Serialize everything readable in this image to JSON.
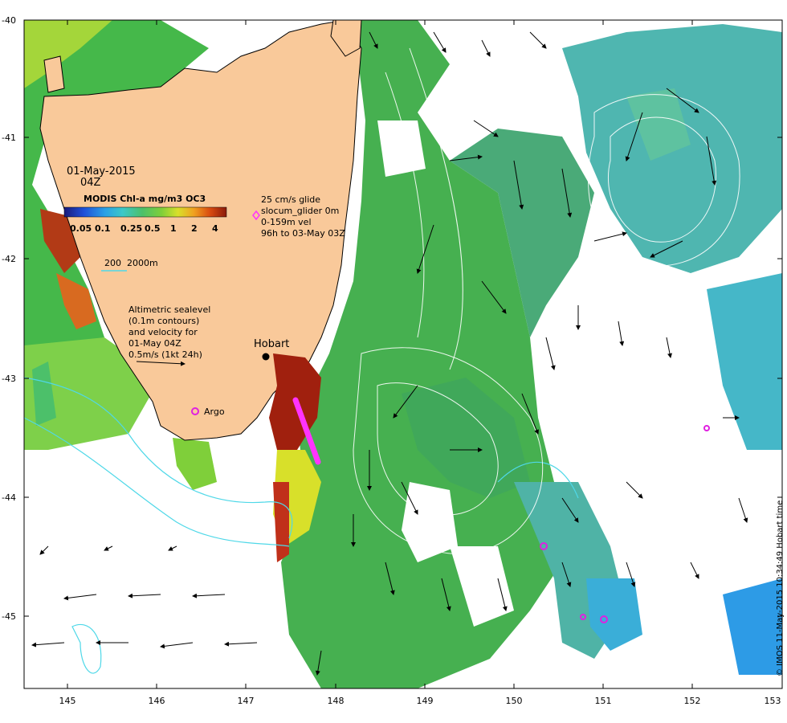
{
  "map": {
    "date": "01-May-2015",
    "time": "04Z",
    "colorbar": {
      "title": "MODIS Chl-a mg/m3 OC3",
      "tick_labels": [
        "0.05",
        "0.1",
        "0.25",
        "0.5",
        "1",
        "2",
        "4"
      ],
      "colors": [
        "#1a1a7a",
        "#1f4fd8",
        "#2aa0e6",
        "#3cc8c8",
        "#4cc06a",
        "#7fcf3a",
        "#d8e02a",
        "#f0a020",
        "#d84a10",
        "#8a1a0a"
      ]
    },
    "glider_legend": {
      "line1": "25 cm/s glide",
      "line2": "slocum_glider 0m",
      "line3": "0-159m vel",
      "line4": "96h to 03-May 03Z"
    },
    "depth_legend": {
      "label1": "200",
      "label2": "2000m"
    },
    "altimetry_legend": {
      "line1": "Altimetric sealevel",
      "line2": "(0.1m contours)",
      "line3": "and velocity for",
      "line4": "01-May 04Z",
      "line5": "0.5m/s (1kt 24h)"
    },
    "places": {
      "hobart": "Hobart",
      "argo": "Argo"
    },
    "credit": "© IMOS 11-May-2015 10:34:49 Hobart time",
    "x_ticks": [
      "145",
      "146",
      "147",
      "148",
      "149",
      "150",
      "151",
      "152",
      "153"
    ],
    "y_ticks": [
      "-40",
      "-41",
      "-42",
      "-43",
      "-44",
      "-45"
    ],
    "colors": {
      "land": "#f9c99a",
      "ocean_green": "#3fae4a",
      "ocean_cyan": "#49b8c0",
      "ocean_blue": "#2a8ee0",
      "glider_track": "#ff33ff",
      "argo_marker": "#e020e0",
      "bathy_contour": "#4fd8e8",
      "sealevel_contour": "#ffffff"
    }
  }
}
